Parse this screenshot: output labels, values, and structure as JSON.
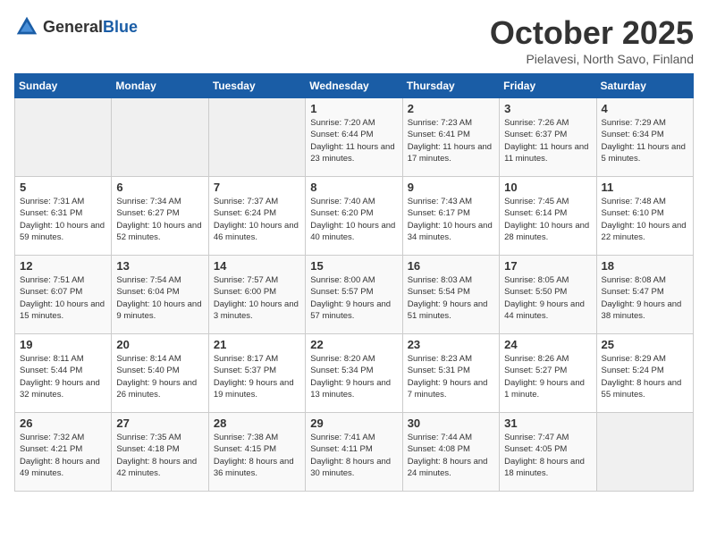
{
  "logo": {
    "general": "General",
    "blue": "Blue"
  },
  "header": {
    "month": "October 2025",
    "location": "Pielavesi, North Savo, Finland"
  },
  "days_of_week": [
    "Sunday",
    "Monday",
    "Tuesday",
    "Wednesday",
    "Thursday",
    "Friday",
    "Saturday"
  ],
  "weeks": [
    [
      {
        "day": "",
        "sunrise": "",
        "sunset": "",
        "daylight": ""
      },
      {
        "day": "",
        "sunrise": "",
        "sunset": "",
        "daylight": ""
      },
      {
        "day": "",
        "sunrise": "",
        "sunset": "",
        "daylight": ""
      },
      {
        "day": "1",
        "sunrise": "Sunrise: 7:20 AM",
        "sunset": "Sunset: 6:44 PM",
        "daylight": "Daylight: 11 hours and 23 minutes."
      },
      {
        "day": "2",
        "sunrise": "Sunrise: 7:23 AM",
        "sunset": "Sunset: 6:41 PM",
        "daylight": "Daylight: 11 hours and 17 minutes."
      },
      {
        "day": "3",
        "sunrise": "Sunrise: 7:26 AM",
        "sunset": "Sunset: 6:37 PM",
        "daylight": "Daylight: 11 hours and 11 minutes."
      },
      {
        "day": "4",
        "sunrise": "Sunrise: 7:29 AM",
        "sunset": "Sunset: 6:34 PM",
        "daylight": "Daylight: 11 hours and 5 minutes."
      }
    ],
    [
      {
        "day": "5",
        "sunrise": "Sunrise: 7:31 AM",
        "sunset": "Sunset: 6:31 PM",
        "daylight": "Daylight: 10 hours and 59 minutes."
      },
      {
        "day": "6",
        "sunrise": "Sunrise: 7:34 AM",
        "sunset": "Sunset: 6:27 PM",
        "daylight": "Daylight: 10 hours and 52 minutes."
      },
      {
        "day": "7",
        "sunrise": "Sunrise: 7:37 AM",
        "sunset": "Sunset: 6:24 PM",
        "daylight": "Daylight: 10 hours and 46 minutes."
      },
      {
        "day": "8",
        "sunrise": "Sunrise: 7:40 AM",
        "sunset": "Sunset: 6:20 PM",
        "daylight": "Daylight: 10 hours and 40 minutes."
      },
      {
        "day": "9",
        "sunrise": "Sunrise: 7:43 AM",
        "sunset": "Sunset: 6:17 PM",
        "daylight": "Daylight: 10 hours and 34 minutes."
      },
      {
        "day": "10",
        "sunrise": "Sunrise: 7:45 AM",
        "sunset": "Sunset: 6:14 PM",
        "daylight": "Daylight: 10 hours and 28 minutes."
      },
      {
        "day": "11",
        "sunrise": "Sunrise: 7:48 AM",
        "sunset": "Sunset: 6:10 PM",
        "daylight": "Daylight: 10 hours and 22 minutes."
      }
    ],
    [
      {
        "day": "12",
        "sunrise": "Sunrise: 7:51 AM",
        "sunset": "Sunset: 6:07 PM",
        "daylight": "Daylight: 10 hours and 15 minutes."
      },
      {
        "day": "13",
        "sunrise": "Sunrise: 7:54 AM",
        "sunset": "Sunset: 6:04 PM",
        "daylight": "Daylight: 10 hours and 9 minutes."
      },
      {
        "day": "14",
        "sunrise": "Sunrise: 7:57 AM",
        "sunset": "Sunset: 6:00 PM",
        "daylight": "Daylight: 10 hours and 3 minutes."
      },
      {
        "day": "15",
        "sunrise": "Sunrise: 8:00 AM",
        "sunset": "Sunset: 5:57 PM",
        "daylight": "Daylight: 9 hours and 57 minutes."
      },
      {
        "day": "16",
        "sunrise": "Sunrise: 8:03 AM",
        "sunset": "Sunset: 5:54 PM",
        "daylight": "Daylight: 9 hours and 51 minutes."
      },
      {
        "day": "17",
        "sunrise": "Sunrise: 8:05 AM",
        "sunset": "Sunset: 5:50 PM",
        "daylight": "Daylight: 9 hours and 44 minutes."
      },
      {
        "day": "18",
        "sunrise": "Sunrise: 8:08 AM",
        "sunset": "Sunset: 5:47 PM",
        "daylight": "Daylight: 9 hours and 38 minutes."
      }
    ],
    [
      {
        "day": "19",
        "sunrise": "Sunrise: 8:11 AM",
        "sunset": "Sunset: 5:44 PM",
        "daylight": "Daylight: 9 hours and 32 minutes."
      },
      {
        "day": "20",
        "sunrise": "Sunrise: 8:14 AM",
        "sunset": "Sunset: 5:40 PM",
        "daylight": "Daylight: 9 hours and 26 minutes."
      },
      {
        "day": "21",
        "sunrise": "Sunrise: 8:17 AM",
        "sunset": "Sunset: 5:37 PM",
        "daylight": "Daylight: 9 hours and 19 minutes."
      },
      {
        "day": "22",
        "sunrise": "Sunrise: 8:20 AM",
        "sunset": "Sunset: 5:34 PM",
        "daylight": "Daylight: 9 hours and 13 minutes."
      },
      {
        "day": "23",
        "sunrise": "Sunrise: 8:23 AM",
        "sunset": "Sunset: 5:31 PM",
        "daylight": "Daylight: 9 hours and 7 minutes."
      },
      {
        "day": "24",
        "sunrise": "Sunrise: 8:26 AM",
        "sunset": "Sunset: 5:27 PM",
        "daylight": "Daylight: 9 hours and 1 minute."
      },
      {
        "day": "25",
        "sunrise": "Sunrise: 8:29 AM",
        "sunset": "Sunset: 5:24 PM",
        "daylight": "Daylight: 8 hours and 55 minutes."
      }
    ],
    [
      {
        "day": "26",
        "sunrise": "Sunrise: 7:32 AM",
        "sunset": "Sunset: 4:21 PM",
        "daylight": "Daylight: 8 hours and 49 minutes."
      },
      {
        "day": "27",
        "sunrise": "Sunrise: 7:35 AM",
        "sunset": "Sunset: 4:18 PM",
        "daylight": "Daylight: 8 hours and 42 minutes."
      },
      {
        "day": "28",
        "sunrise": "Sunrise: 7:38 AM",
        "sunset": "Sunset: 4:15 PM",
        "daylight": "Daylight: 8 hours and 36 minutes."
      },
      {
        "day": "29",
        "sunrise": "Sunrise: 7:41 AM",
        "sunset": "Sunset: 4:11 PM",
        "daylight": "Daylight: 8 hours and 30 minutes."
      },
      {
        "day": "30",
        "sunrise": "Sunrise: 7:44 AM",
        "sunset": "Sunset: 4:08 PM",
        "daylight": "Daylight: 8 hours and 24 minutes."
      },
      {
        "day": "31",
        "sunrise": "Sunrise: 7:47 AM",
        "sunset": "Sunset: 4:05 PM",
        "daylight": "Daylight: 8 hours and 18 minutes."
      },
      {
        "day": "",
        "sunrise": "",
        "sunset": "",
        "daylight": ""
      }
    ]
  ]
}
